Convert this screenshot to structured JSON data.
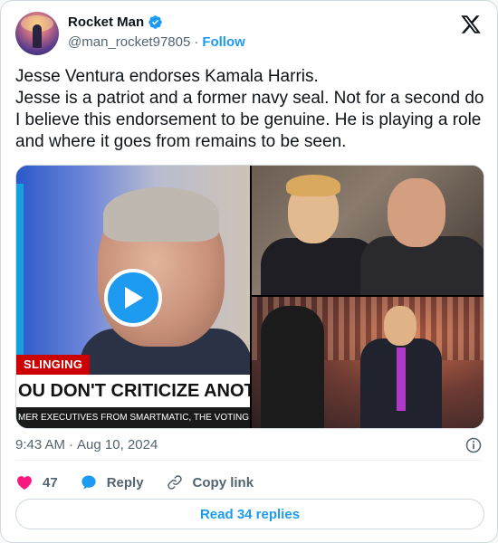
{
  "user": {
    "display_name": "Rocket Man",
    "handle": "@man_rocket97805",
    "separator": "·",
    "follow_label": "Follow"
  },
  "tweet": {
    "text": "Jesse Ventura endorses Kamala Harris.\nJesse is a patriot and a former navy seal. Not for a second do I believe this endorsement to be genuine. He is playing a role and where it goes from remains to be seen."
  },
  "media": {
    "video_tag": "SLINGING",
    "video_headline": "OU DON'T CRITICIZE ANOTHER VETE",
    "video_ticker": "MER EXECUTIVES FROM SMARTMATIC, THE VOTING T"
  },
  "meta": {
    "time": "9:43 AM",
    "separator": "·",
    "date": "Aug 10, 2024"
  },
  "actions": {
    "like_count": "47",
    "reply_label": "Reply",
    "copy_link_label": "Copy link"
  },
  "footer": {
    "read_replies_label": "Read 34 replies"
  },
  "colors": {
    "accent": "#1d9bf0",
    "like": "#f91880",
    "text_secondary": "#536471"
  },
  "icons": [
    "verified-badge-icon",
    "x-logo-icon",
    "play-icon",
    "info-icon",
    "heart-icon",
    "reply-icon",
    "link-icon"
  ]
}
